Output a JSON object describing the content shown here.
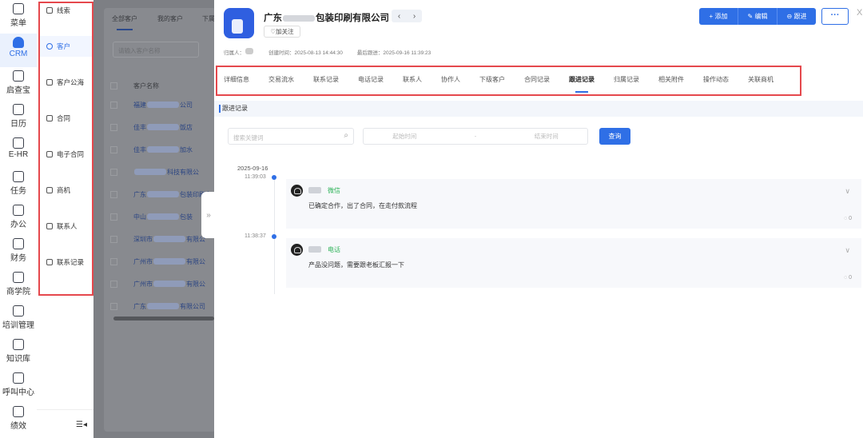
{
  "nav": [
    {
      "label": "菜单",
      "icon": "menu-grid-icon"
    },
    {
      "label": "CRM",
      "icon": "crm-user-icon",
      "active": true
    },
    {
      "label": "启查宝",
      "icon": "search-chart-icon"
    },
    {
      "label": "日历",
      "icon": "calendar-icon"
    },
    {
      "label": "E-HR",
      "icon": "ehr-icon"
    },
    {
      "label": "任务",
      "icon": "task-icon"
    },
    {
      "label": "办公",
      "icon": "office-icon"
    },
    {
      "label": "财务",
      "icon": "finance-icon"
    },
    {
      "label": "商学院",
      "icon": "graduation-cap-icon"
    },
    {
      "label": "培训管理",
      "icon": "training-icon"
    },
    {
      "label": "知识库",
      "icon": "knowledge-icon"
    },
    {
      "label": "呼叫中心",
      "icon": "call-center-icon"
    },
    {
      "label": "绩效",
      "icon": "performance-icon"
    }
  ],
  "submenu": [
    {
      "label": "线索"
    },
    {
      "label": "客户",
      "active": true
    },
    {
      "label": "客户公海"
    },
    {
      "label": "合同"
    },
    {
      "label": "电子合同"
    },
    {
      "label": "商机"
    },
    {
      "label": "联系人"
    },
    {
      "label": "联系记录"
    }
  ],
  "background_list": {
    "tabs": [
      "全部客户",
      "我的客户",
      "下属"
    ],
    "search_placeholder": "请输入客户名称",
    "column": "客户名称",
    "rows": [
      [
        "福建",
        "公司"
      ],
      [
        "佳丰",
        "饭店"
      ],
      [
        "佳丰",
        "加水"
      ],
      [
        "",
        "科技有限公"
      ],
      [
        "广东",
        "包装印刷有"
      ],
      [
        "中山",
        "包装"
      ],
      [
        "深圳市",
        "有限公"
      ],
      [
        "广州市",
        "有限公"
      ],
      [
        "广州市",
        "有限公"
      ],
      [
        "广东",
        "有限公司"
      ]
    ]
  },
  "drawer": {
    "title_prefix": "广东",
    "title_suffix": "包装印刷有限公司",
    "follow_label": "♡加关注",
    "actions": {
      "add": "+ 添加",
      "edit": "✎ 编辑",
      "followup": "⊖ 跟进",
      "more": "···",
      "close": "X"
    },
    "meta": {
      "owner_label": "归属人：",
      "created_label": "创建时间：",
      "created": "2025-08-13 14:44:30",
      "last_label": "最后跟进：",
      "last": "2025-09-16 11:39:23"
    },
    "tabs": [
      "详细信息",
      "交易流水",
      "联系记录",
      "电话记录",
      "联系人",
      "协作人",
      "下级客户",
      "合同记录",
      "跟进记录",
      "归属记录",
      "相关附件",
      "操作动态",
      "关联商机"
    ],
    "active_tab": "跟进记录",
    "section_title": "跟进记录",
    "search_placeholder": "搜索关键词",
    "start_placeholder": "起始时间",
    "range_sep": "-",
    "end_placeholder": "结束时间",
    "query_label": "查询",
    "date": "2025-09-16",
    "records": [
      {
        "time": "11:39:03",
        "type": "微信",
        "content": "已确定合作，出了合同，在走付款流程",
        "comments": "0"
      },
      {
        "time": "11:38:37",
        "type": "电话",
        "content": "产品没问题，需要跟老板汇报一下",
        "comments": "0"
      }
    ]
  }
}
